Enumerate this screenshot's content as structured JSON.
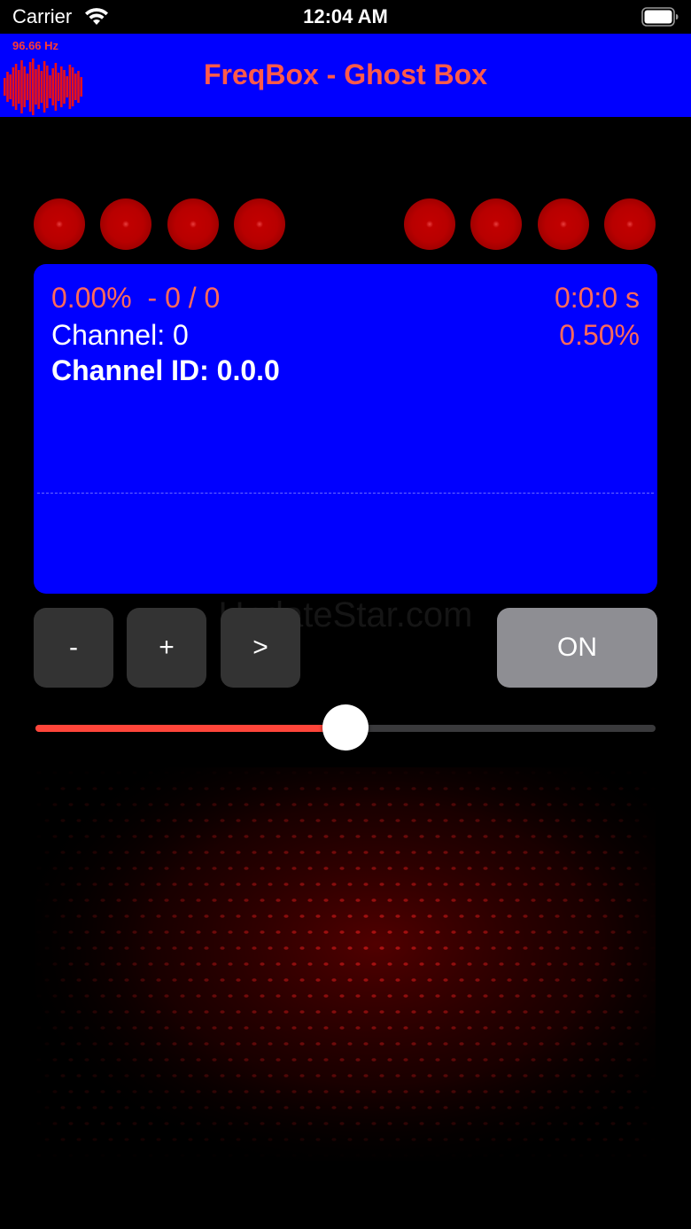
{
  "status_bar": {
    "carrier": "Carrier",
    "time": "12:04 AM",
    "wifi_icon": "wifi-icon",
    "battery_icon": "battery-icon"
  },
  "header": {
    "title": "FreqBox - Ghost Box",
    "logo_frequency": "96.66 Hz",
    "background_color": "#0000ff",
    "title_color": "#ff5a4a"
  },
  "indicators": {
    "count": 8,
    "color": "#b80000"
  },
  "info_panel": {
    "progress": "0.00%  - 0 / 0",
    "time": "0:0:0 s",
    "channel": "Channel: 0",
    "rate": "0.50%",
    "channel_id": "Channel ID: 0.0.0"
  },
  "watermark": "UpdateStar.com",
  "controls": {
    "minus_label": "-",
    "plus_label": "+",
    "next_label": ">",
    "power_label": "ON"
  },
  "slider": {
    "value": 0.5,
    "fill_color": "#ff453a"
  }
}
